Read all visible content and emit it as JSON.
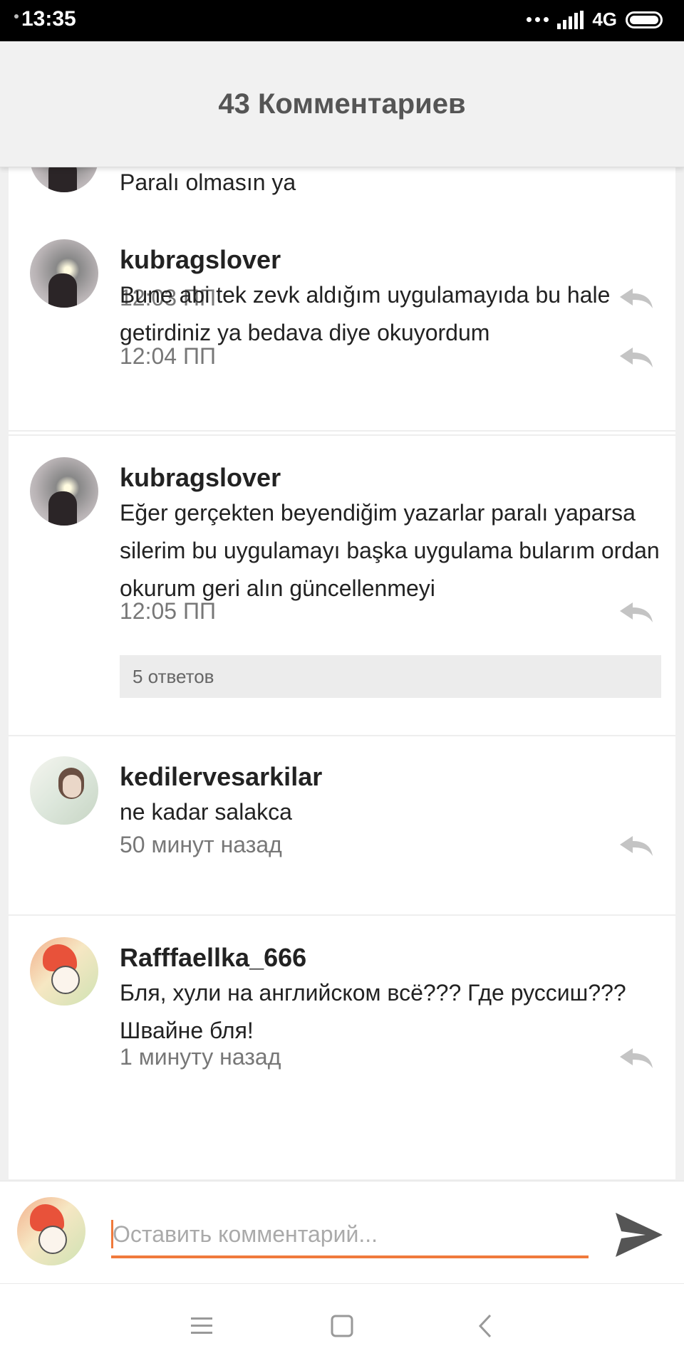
{
  "status_bar": {
    "time": "13:35",
    "network": "4G"
  },
  "header": {
    "title": "43 Комментариев"
  },
  "comments": [
    {
      "username": "",
      "text": "Paralı olmasın ya",
      "time": "12:03 ПП",
      "avatar": "partial-avatar"
    },
    {
      "username": "kubragslover",
      "text": "Bune abi tek zevk aldığım uygulamayıda bu hale getirdiniz ya bedava diye okuyordum",
      "time": "12:04 ПП",
      "avatar": "dark-photo-avatar"
    },
    {
      "username": "kubragslover",
      "text": "Eğer gerçekten beyendiğim yazarlar paralı yaparsa silerim bu uygulamayı başka uygulama bularım ordan okurum geri alın güncellenmeyi",
      "time": "12:05 ПП",
      "replies_label": "5 ответов",
      "avatar": "dark-photo-avatar"
    },
    {
      "username": "kedilervesarkilar",
      "text": "ne kadar salakca",
      "time": "50 минут назад",
      "avatar": "light-photo-avatar"
    },
    {
      "username": "Rafffaellka_666",
      "text": "Бля, хули на английском всё??? Где руссиш??? Швайне бля!",
      "time": "1 минуту назад",
      "avatar": "cartoon-avatar"
    }
  ],
  "composer": {
    "placeholder": "Оставить комментарий...",
    "send_icon": "send-icon"
  },
  "colors": {
    "accent": "#f07a3c",
    "time_text": "#777777",
    "header_bg": "#f1f1f1"
  },
  "nav": {
    "icons": [
      "menu-icon",
      "home-icon",
      "back-icon"
    ]
  }
}
